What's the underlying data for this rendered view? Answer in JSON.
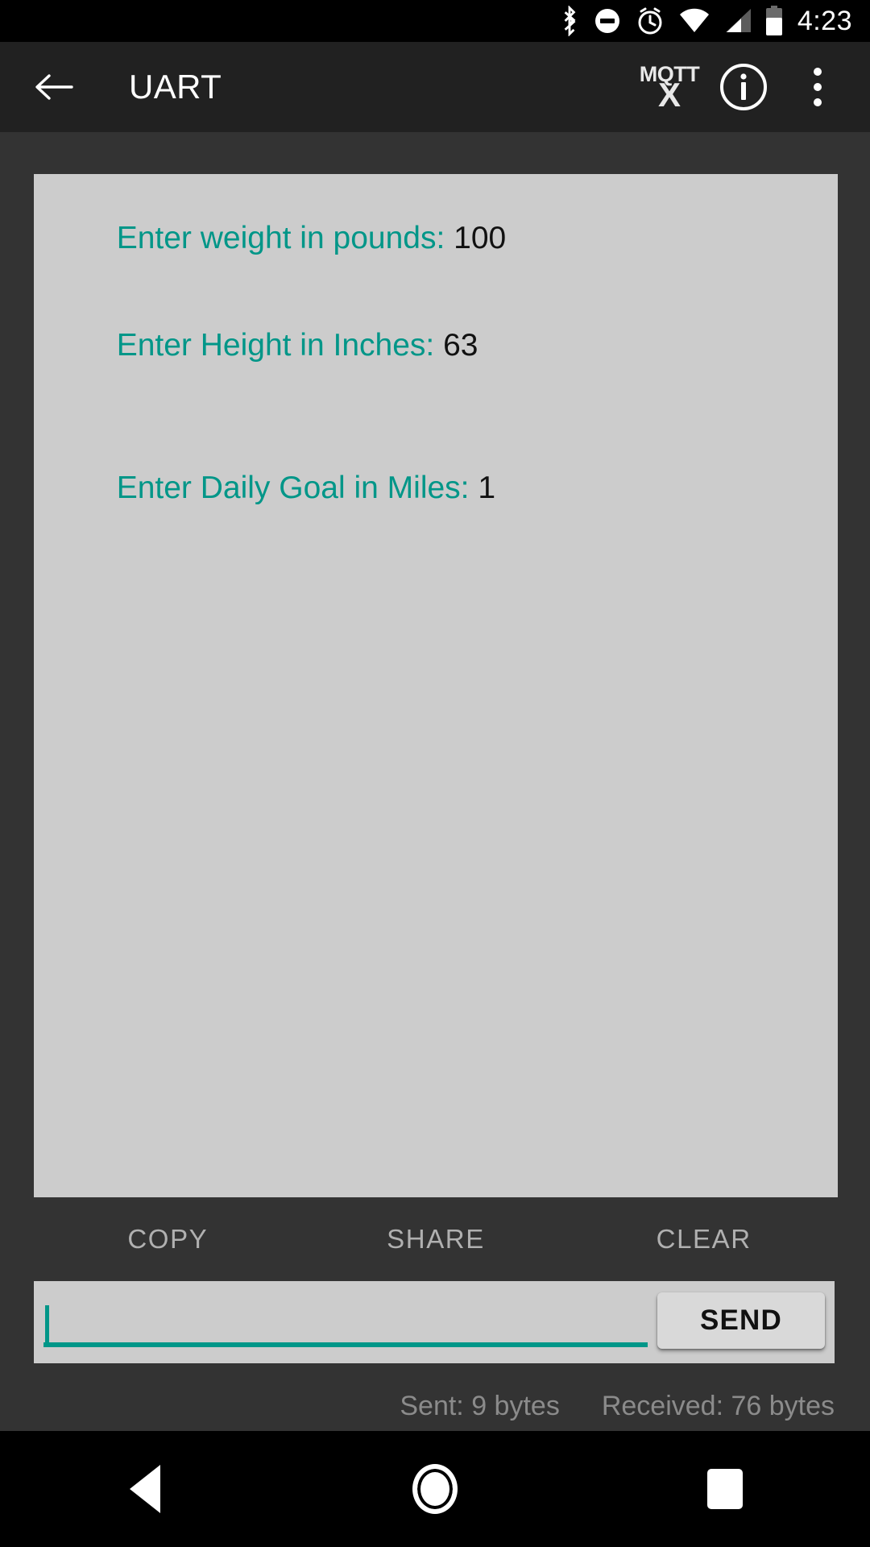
{
  "status_bar": {
    "time": "4:23",
    "icons": [
      "bluetooth-icon",
      "do-not-disturb-icon",
      "alarm-icon",
      "wifi-icon",
      "cellular-signal-icon",
      "battery-icon"
    ]
  },
  "app_bar": {
    "back_label": "back-arrow",
    "title": "UART",
    "mqtt_line1": "MQTT",
    "mqtt_line2": "X",
    "info_label": "i",
    "overflow_label": "overflow-menu"
  },
  "console": {
    "lines": [
      {
        "prompt": "Enter weight in pounds: ",
        "value": "100"
      },
      {
        "prompt": "Enter Height in Inches: ",
        "value": "63"
      },
      {
        "prompt": "",
        "value": ""
      },
      {
        "prompt": "Enter Daily Goal in Miles: ",
        "value": "1"
      }
    ],
    "text_color": "#009688",
    "value_color": "#111111",
    "background": "#cccccc"
  },
  "actions": {
    "copy_label": "COPY",
    "share_label": "SHARE",
    "clear_label": "CLEAR"
  },
  "input": {
    "value": "",
    "placeholder": "",
    "send_label": "SEND",
    "accent_color": "#009688"
  },
  "stats": {
    "sent": "Sent: 9 bytes",
    "received": "Received: 76 bytes"
  },
  "nav_bar": {
    "back": "back-nav",
    "home": "home-nav",
    "recents": "recents-nav"
  }
}
